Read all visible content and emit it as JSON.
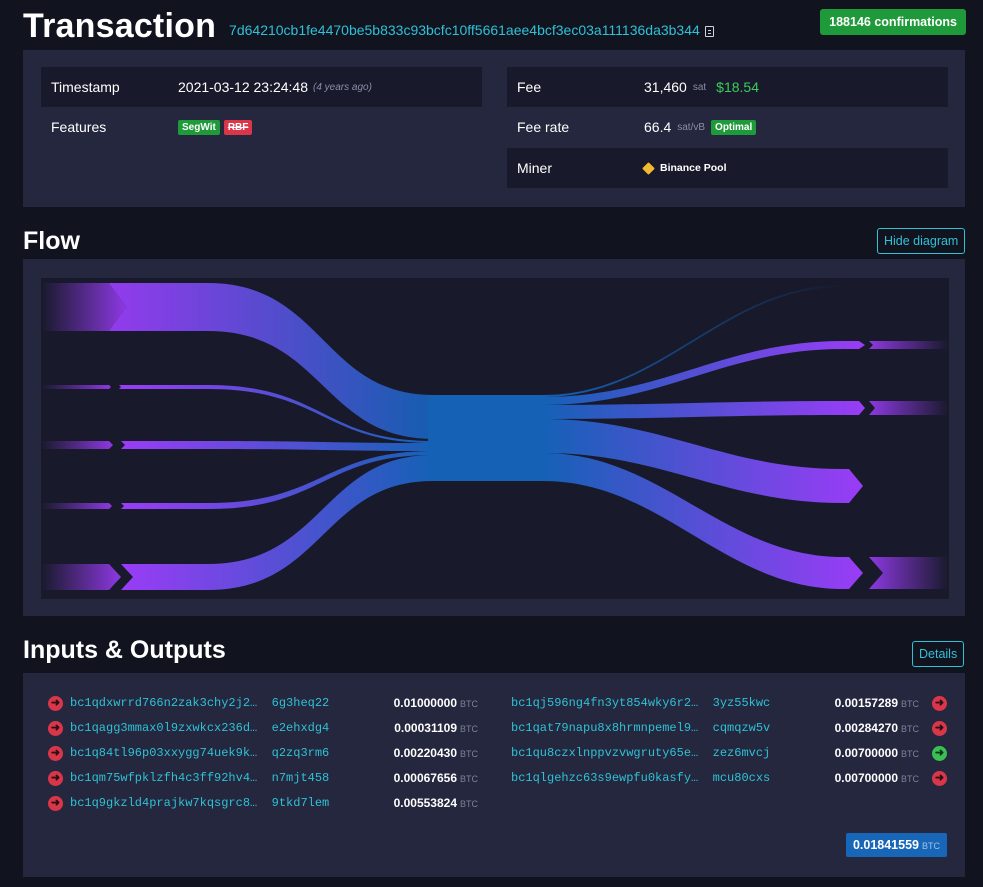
{
  "header": {
    "title": "Transaction",
    "txid": "7d64210cb1fe4470be5b833c93bcfc10ff5661aee4bcf3ec03a111136da3b344",
    "confirmations": "188146 confirmations"
  },
  "details": {
    "timestamp_label": "Timestamp",
    "timestamp_value": "2021-03-12 23:24:48",
    "timestamp_relative": "(4 years ago)",
    "features_label": "Features",
    "feature_badges": [
      "SegWit",
      "RBF"
    ],
    "fee_label": "Fee",
    "fee_value": "31,460",
    "fee_unit": "sat",
    "fee_usd": "$18.54",
    "feerate_label": "Fee rate",
    "feerate_value": "66.4",
    "feerate_unit": "sat/vB",
    "feerate_badge": "Optimal",
    "miner_label": "Miner",
    "miner_value": "Binance Pool"
  },
  "flow": {
    "title": "Flow",
    "toggle_label": "Hide diagram"
  },
  "io": {
    "title": "Inputs & Outputs",
    "details_label": "Details",
    "unit": "BTC",
    "inputs": [
      {
        "addr_start": "bc1qdxwrrd766n2zak3chy2j2…",
        "addr_end": "6g3heq22",
        "amount": "0.01000000"
      },
      {
        "addr_start": "bc1qagg3mmax0l9zxwkcx236d…",
        "addr_end": "e2ehxdg4",
        "amount": "0.00031109"
      },
      {
        "addr_start": "bc1q84tl96p03xxygg74uek9k…",
        "addr_end": "q2zq3rm6",
        "amount": "0.00220430"
      },
      {
        "addr_start": "bc1qm75wfpklzfh4c3ff92hv4…",
        "addr_end": "n7mjt458",
        "amount": "0.00067656"
      },
      {
        "addr_start": "bc1q9gkzld4prajkw7kqsgrc8…",
        "addr_end": "9tkd7lem",
        "amount": "0.00553824"
      }
    ],
    "outputs": [
      {
        "addr_start": "bc1qj596ng4fn3yt854wky6r2…",
        "addr_end": "3yz55kwc",
        "amount": "0.00157289",
        "status": "spent"
      },
      {
        "addr_start": "bc1qat79napu8x8hrmnpemel9…",
        "addr_end": "cqmqzw5v",
        "amount": "0.00284270",
        "status": "spent"
      },
      {
        "addr_start": "bc1qu8czxlnppvzvwgruty65e…",
        "addr_end": "zez6mvcj",
        "amount": "0.00700000",
        "status": "unspent"
      },
      {
        "addr_start": "bc1qlgehzc63s9ewpfu0kasfy…",
        "addr_end": "mcu80cxs",
        "amount": "0.00700000",
        "status": "spent"
      }
    ],
    "total": "0.01841559"
  },
  "colors": {
    "accent": "#2fc1d6",
    "flow_purple": "#9339f4",
    "flow_blue": "#105fb0",
    "confirm_green": "#1f9a3a",
    "rbf_red": "#d9364a"
  }
}
